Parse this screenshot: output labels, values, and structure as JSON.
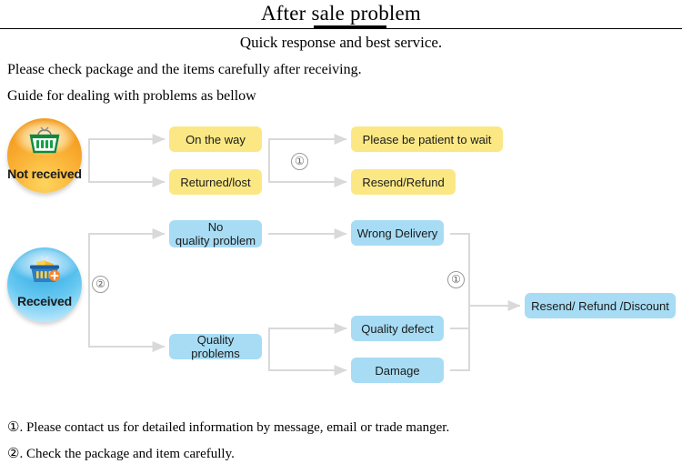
{
  "header": {
    "title": "After sale problem",
    "subtitle": "Quick response and best service.",
    "line1": "Please check package and the items carefully after receiving.",
    "line2": "Guide for dealing with problems as bellow"
  },
  "colors": {
    "yellow_box": "#FBE884",
    "blue_box": "#A7DCF4",
    "connector": "#D9D9D9",
    "marker_outline": "#9A9A9A",
    "orange_circle": "#F5A024",
    "blue_circle": "#3EB2E8",
    "rule": "#000000"
  },
  "flow": {
    "nodes": {
      "not_received": {
        "label": "Not received",
        "icon": "shopping-basket-icon"
      },
      "received": {
        "label": "Received",
        "icon": "shopping-basket-filled-icon"
      }
    },
    "branch_not_received": [
      {
        "label": "On the way",
        "color": "yellow"
      },
      {
        "label": "Returned/lost",
        "color": "yellow"
      }
    ],
    "outcomes_not_received": [
      {
        "label": "Please be patient to wait",
        "color": "yellow"
      },
      {
        "label": "Resend/Refund",
        "color": "yellow"
      }
    ],
    "branch_received": [
      {
        "label": "No\nquality problem",
        "line1": "No",
        "line2": "quality problem",
        "color": "blue"
      },
      {
        "label": "Quality problems",
        "color": "blue"
      }
    ],
    "issues_received": [
      {
        "label": "Wrong Delivery",
        "color": "blue"
      },
      {
        "label": "Quality defect",
        "color": "blue"
      },
      {
        "label": "Damage",
        "color": "blue"
      }
    ],
    "final_outcome": {
      "label": "Resend/ Refund /Discount",
      "color": "blue"
    },
    "markers": {
      "top": "①",
      "left": "②",
      "right": "①"
    }
  },
  "footnotes": [
    "①. Please contact us for detailed information by message, email or trade manger.",
    "②. Check the package and item carefully."
  ]
}
